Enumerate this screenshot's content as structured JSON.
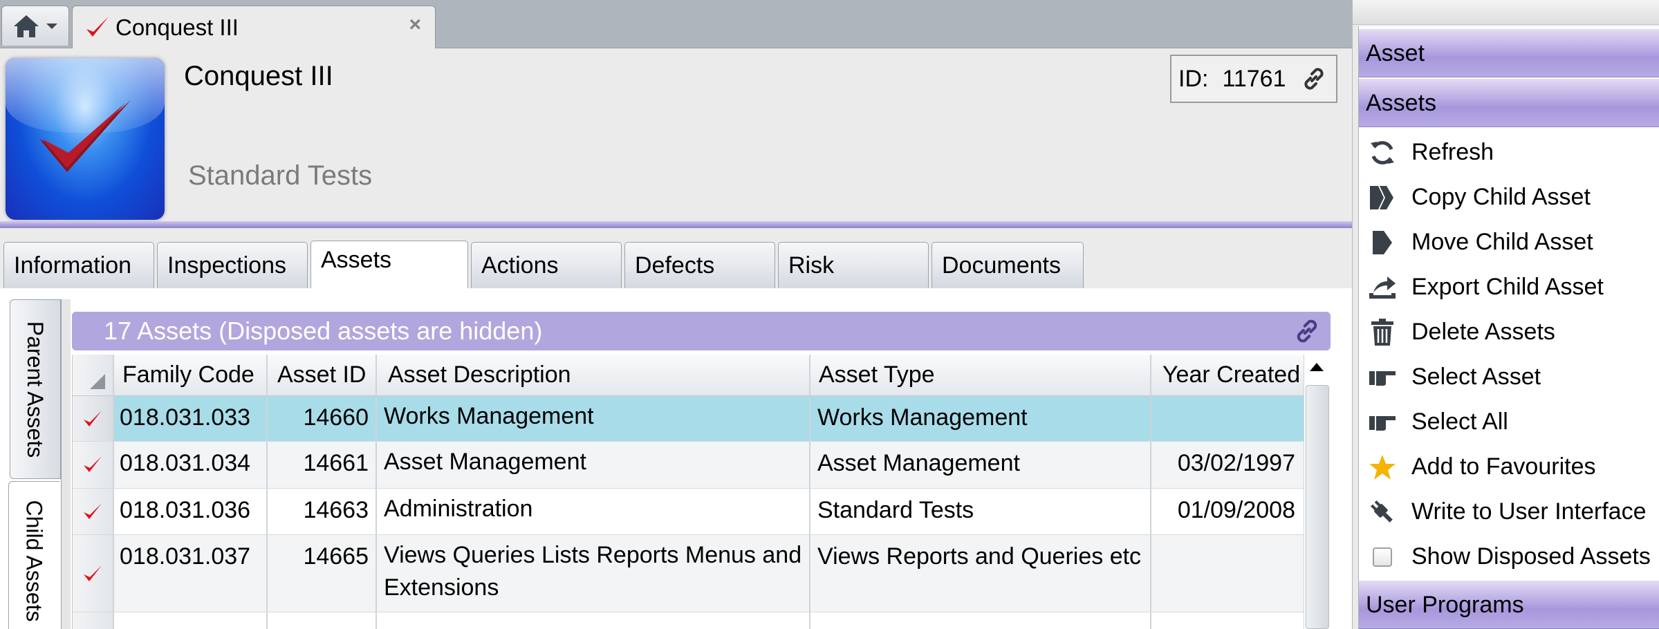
{
  "doc_tab": {
    "title": "Conquest III",
    "close": "×"
  },
  "header": {
    "name": "Conquest III",
    "subtitle": "Standard Tests",
    "id_label": "ID:",
    "id_value": "11761"
  },
  "tabs": [
    "Information",
    "Inspections",
    "Assets",
    "Actions",
    "Defects",
    "Risk",
    "Documents"
  ],
  "active_tab": "Assets",
  "side_tabs": {
    "parent": "Parent Assets",
    "child": "Child Assets"
  },
  "grid": {
    "title": "17 Assets (Disposed assets are hidden)",
    "columns": [
      "Family Code",
      "Asset ID",
      "Asset Description",
      "Asset Type",
      "Year Created"
    ],
    "rows": [
      {
        "family": "018.031.033",
        "id": "14660",
        "desc": "Works Management",
        "type": "Works Management",
        "year": ""
      },
      {
        "family": "018.031.034",
        "id": "14661",
        "desc": "Asset Management",
        "type": "Asset Management",
        "year": "03/02/1997"
      },
      {
        "family": "018.031.036",
        "id": "14663",
        "desc": "Administration",
        "type": "Standard Tests",
        "year": "01/09/2008"
      },
      {
        "family": "018.031.037",
        "id": "14665",
        "desc": "Views Queries Lists Reports Menus and Extensions",
        "type": "Views Reports and Queries etc",
        "year": ""
      }
    ]
  },
  "panel": {
    "asset_header": "Asset",
    "assets_header": "Assets",
    "actions": [
      {
        "label": "Refresh",
        "icon": "refresh-icon"
      },
      {
        "label": "Copy Child Asset",
        "icon": "copy-icon"
      },
      {
        "label": "Move Child Asset",
        "icon": "move-icon"
      },
      {
        "label": "Export Child Asset",
        "icon": "export-icon"
      },
      {
        "label": "Delete Assets",
        "icon": "trash-icon"
      },
      {
        "label": "Select Asset",
        "icon": "pointing-hand-icon"
      },
      {
        "label": "Select All",
        "icon": "pointing-hand-icon"
      },
      {
        "label": "Add to Favourites",
        "icon": "star-icon"
      },
      {
        "label": "Write to User Interface",
        "icon": "plug-icon"
      },
      {
        "label": "Show Disposed Assets",
        "icon": "checkbox-icon"
      }
    ],
    "user_programs_header": "User Programs"
  },
  "colors": {
    "accent_purple": "#a797dc",
    "selection": "#a8dce9",
    "check_red": "#e0101a"
  }
}
